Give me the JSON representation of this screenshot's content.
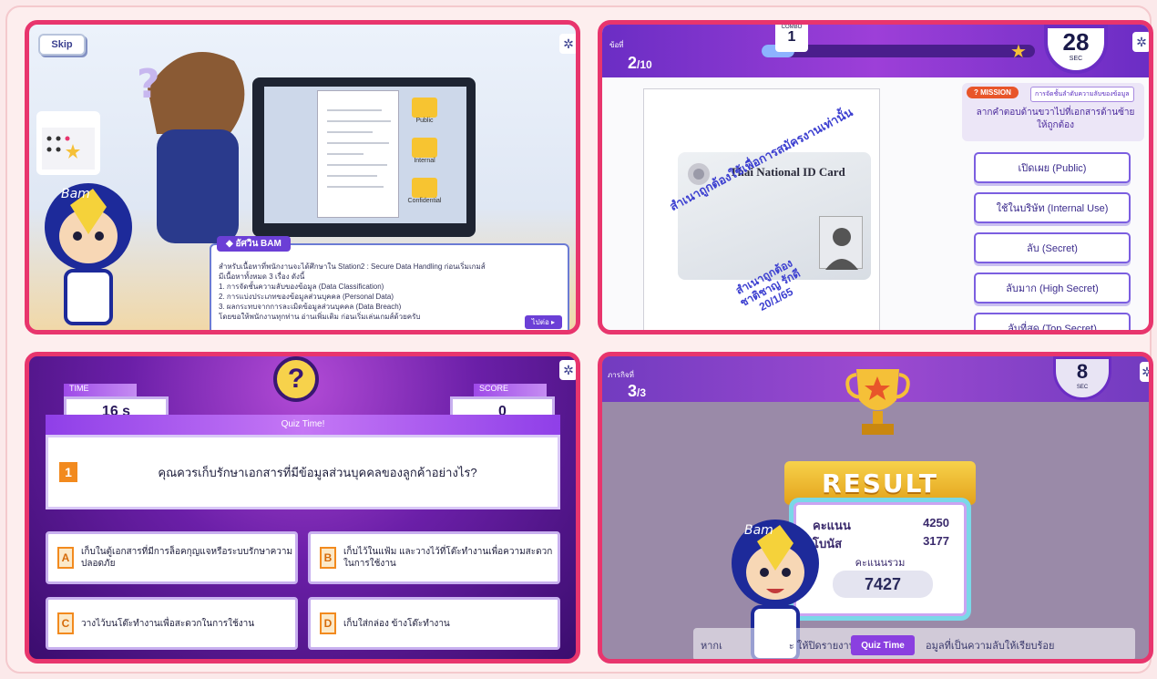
{
  "panel1": {
    "skip_label": "Skip",
    "folders": [
      "Public",
      "Internal",
      "Confidential"
    ],
    "dialog": {
      "speaker": "◆ อัศวิน BAM",
      "lines": [
        "สำหรับเนื้อหาที่พนักงานจะได้ศึกษาใน Station2 : Secure Data Handling ก่อนเริ่มเกมส์",
        "มีเนื้อหาทั้งหมด 3 เรื่อง ดังนี้",
        "1. การจัดชั้นความลับของข้อมูล (Data Classification)",
        "2. การแบ่งประเภทของข้อมูลส่วนบุคคล (Personal Data)",
        "3. ผลกระทบจากการละเมิดข้อมูลส่วนบุคคล (Data Breach)",
        "โดยขอให้พนักงานทุกท่าน อ่านเพิ่มเติม ก่อนเริ่มเล่นเกมส์ด้วยครับ"
      ],
      "next_label": "ไปต่อ ▸"
    }
  },
  "panel2": {
    "round_label": "ข้อที่",
    "question_current": "2",
    "question_total": "/10",
    "combo_label": "COMBO",
    "combo_value": "1",
    "progress": 0.12,
    "timer_value": "28",
    "timer_unit": "SEC",
    "id_title": "Thai National ID Card",
    "stamp_main": "สำเนาถูกต้องใช้เพื่อการสมัครงานเท่านั้น",
    "stamp_sign_1": "สำเนาถูกต้อง",
    "stamp_sign_2": "ชาติชาญ รักดี",
    "stamp_sign_3": "20/1/65",
    "mission_tag": "MISSION",
    "mission_sub": "การจัดชั้นลำดับความลับของข้อมูล",
    "mission_text": "ลากคำตอบด้านขวาไปที่เอกสารด้านซ้ายให้ถูกต้อง",
    "options": [
      "เปิดเผย (Public)",
      "ใช้ในบริษัท (Internal Use)",
      "ลับ (Secret)",
      "ลับมาก (High Secret)",
      "ลับที่สุด (Top Secret)"
    ]
  },
  "panel3": {
    "time_label": "TIME",
    "time_value": "16 s",
    "score_label": "SCORE",
    "score_value": "0",
    "quiz_banner": "Quiz Time!",
    "question_number": "1",
    "question": "คุณควรเก็บรักษาเอกสารที่มีข้อมูลส่วนบุคคลของลูกค้าอย่างไร?",
    "answers": [
      {
        "letter": "A",
        "text": "เก็บในตู้เอกสารที่มีการล็อคกุญแจหรือระบบรักษาความปลอดภัย"
      },
      {
        "letter": "B",
        "text": "เก็บไว้ในแฟ้ม และวางไว้ที่โต๊ะทำงานเพื่อความสะดวกในการใช้งาน"
      },
      {
        "letter": "C",
        "text": "วางไว้บนโต๊ะทำงานเพื่อสะดวกในการใช้งาน"
      },
      {
        "letter": "D",
        "text": "เก็บใส่กล่อง ข้างโต๊ะทำงาน"
      }
    ]
  },
  "panel4": {
    "round_label": "ภารกิจที่",
    "question_current": "3",
    "question_total": "/3",
    "timer_value": "8",
    "timer_unit": "SEC",
    "result_title": "RESULT",
    "score_label": "คะแนน",
    "score_value": "4250",
    "bonus_label": "โบนัส",
    "bonus_value": "3177",
    "total_label": "คะแนนรวม",
    "total_value": "7427",
    "quiz_time_label": "Quiz Time",
    "dialog_left": "หากเ",
    "dialog_mid": "ะ ให้ปิดรายงาน",
    "dialog_right": "อมูลที่เป็นความลับให้เรียบร้อย"
  },
  "colors": {
    "panel_border": "#e8356d",
    "purple": "#6b2dc4",
    "accent_orange": "#f28a1e"
  }
}
